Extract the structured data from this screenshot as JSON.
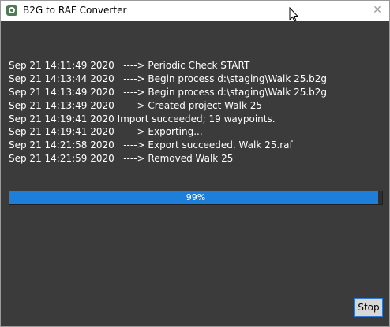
{
  "window": {
    "title": "B2G to RAF Converter",
    "close_glyph": "✕",
    "background_color": "#3b3b3b"
  },
  "log": {
    "lines": [
      "Sep 21 14:11:49 2020   ----> Periodic Check START",
      "Sep 21 14:13:44 2020   ----> Begin process d:\\staging\\Walk 25.b2g",
      "Sep 21 14:13:49 2020   ----> Begin process d:\\staging\\Walk 25.b2g",
      "Sep 21 14:13:49 2020   ----> Created project Walk 25",
      "Sep 21 14:19:41 2020 Import succeeded; 19 waypoints.",
      "Sep 21 14:19:41 2020   ----> Exporting...",
      "Sep 21 14:21:58 2020   ----> Export succeeded. Walk 25.raf",
      "Sep 21 14:21:59 2020   ----> Removed Walk 25"
    ]
  },
  "progress": {
    "value": 99,
    "label": "99%",
    "fill_color": "#1e7fdb"
  },
  "stop_button": {
    "label": "Stop"
  },
  "icons": {
    "app": "app-icon",
    "close": "close-icon",
    "cursor": "mouse-cursor-icon"
  }
}
